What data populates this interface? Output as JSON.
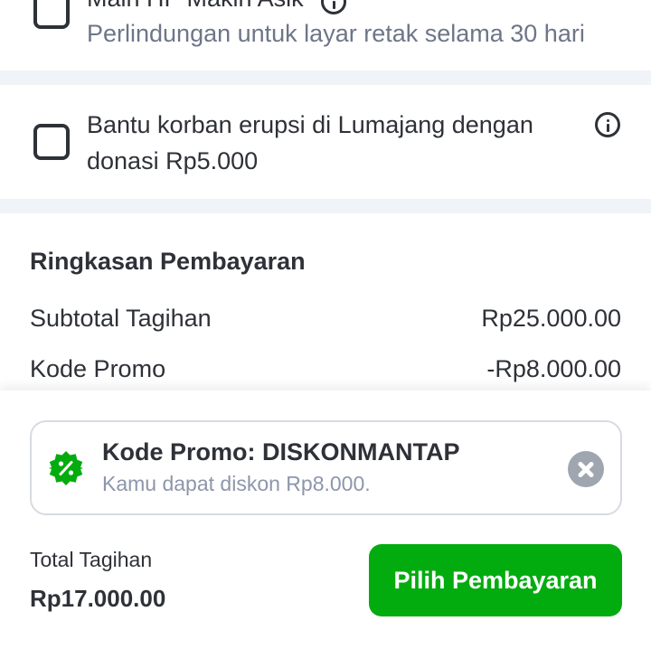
{
  "protection_option": {
    "title": "Main HP Makin Asik",
    "subtitle": "Perlindungan untuk layar retak selama 30 hari"
  },
  "donation_option": {
    "line1": "Bantu korban erupsi di Lumajang dengan",
    "line2": "donasi Rp5.000"
  },
  "summary": {
    "title": "Ringkasan Pembayaran",
    "rows": [
      {
        "label": "Subtotal Tagihan",
        "value": "Rp25.000.00"
      },
      {
        "label": "Kode Promo",
        "value": "-Rp8.000.00"
      }
    ]
  },
  "promo": {
    "title": "Kode Promo: DISKONMANTAP",
    "subtitle": "Kamu dapat diskon Rp8.000."
  },
  "total": {
    "label": "Total Tagihan",
    "value": "Rp17.000.00"
  },
  "pay_button": {
    "label": "Pilih Pembayaran"
  },
  "colors": {
    "accent_green": "#03ac0e",
    "text_primary": "#2e3137",
    "text_secondary": "#6d7588",
    "divider": "#f0f3f7"
  }
}
